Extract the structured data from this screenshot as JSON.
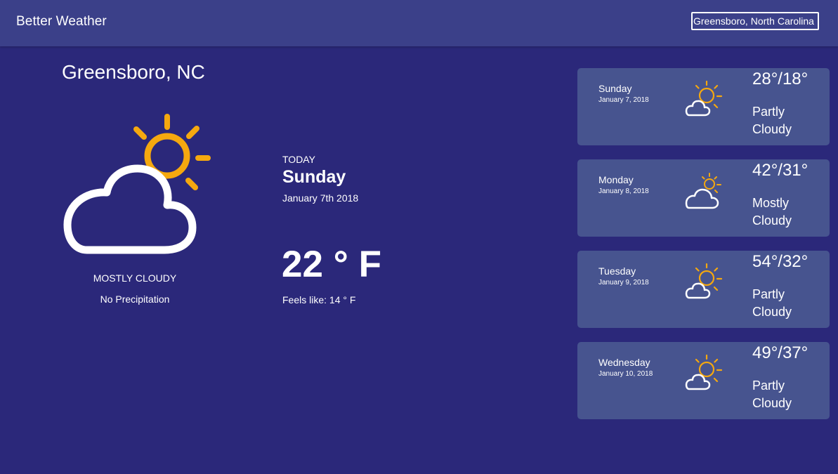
{
  "header": {
    "title": "Better Weather",
    "search_value": "Greensboro, North Carolina"
  },
  "current": {
    "city": "Greensboro, NC",
    "icon": "partly-cloudy-icon",
    "condition": "MOSTLY CLOUDY",
    "precipitation": "No Precipitation",
    "today_label": "TODAY",
    "day": "Sunday",
    "date": "January 7th 2018",
    "temperature": "22 ° F",
    "feels_like": "Feels like: 14 ° F"
  },
  "forecast": [
    {
      "day": "Sunday",
      "date": "January 7, 2018",
      "hilo": "28°/18°",
      "desc_line1": "Partly",
      "desc_line2": "Cloudy",
      "icon": "partly-cloudy-icon"
    },
    {
      "day": "Monday",
      "date": "January 8, 2018",
      "hilo": "42°/31°",
      "desc_line1": "Mostly",
      "desc_line2": "Cloudy",
      "icon": "mostly-cloudy-icon"
    },
    {
      "day": "Tuesday",
      "date": "January 9, 2018",
      "hilo": "54°/32°",
      "desc_line1": "Partly",
      "desc_line2": "Cloudy",
      "icon": "partly-cloudy-icon"
    },
    {
      "day": "Wednesday",
      "date": "January 10, 2018",
      "hilo": "49°/37°",
      "desc_line1": "Partly",
      "desc_line2": "Cloudy",
      "icon": "partly-cloudy-icon"
    }
  ],
  "colors": {
    "background": "#2b287a",
    "topbar": "#3b4089",
    "card": "#47548f",
    "sun": "#f5a80f",
    "cloud": "#ffffff"
  }
}
